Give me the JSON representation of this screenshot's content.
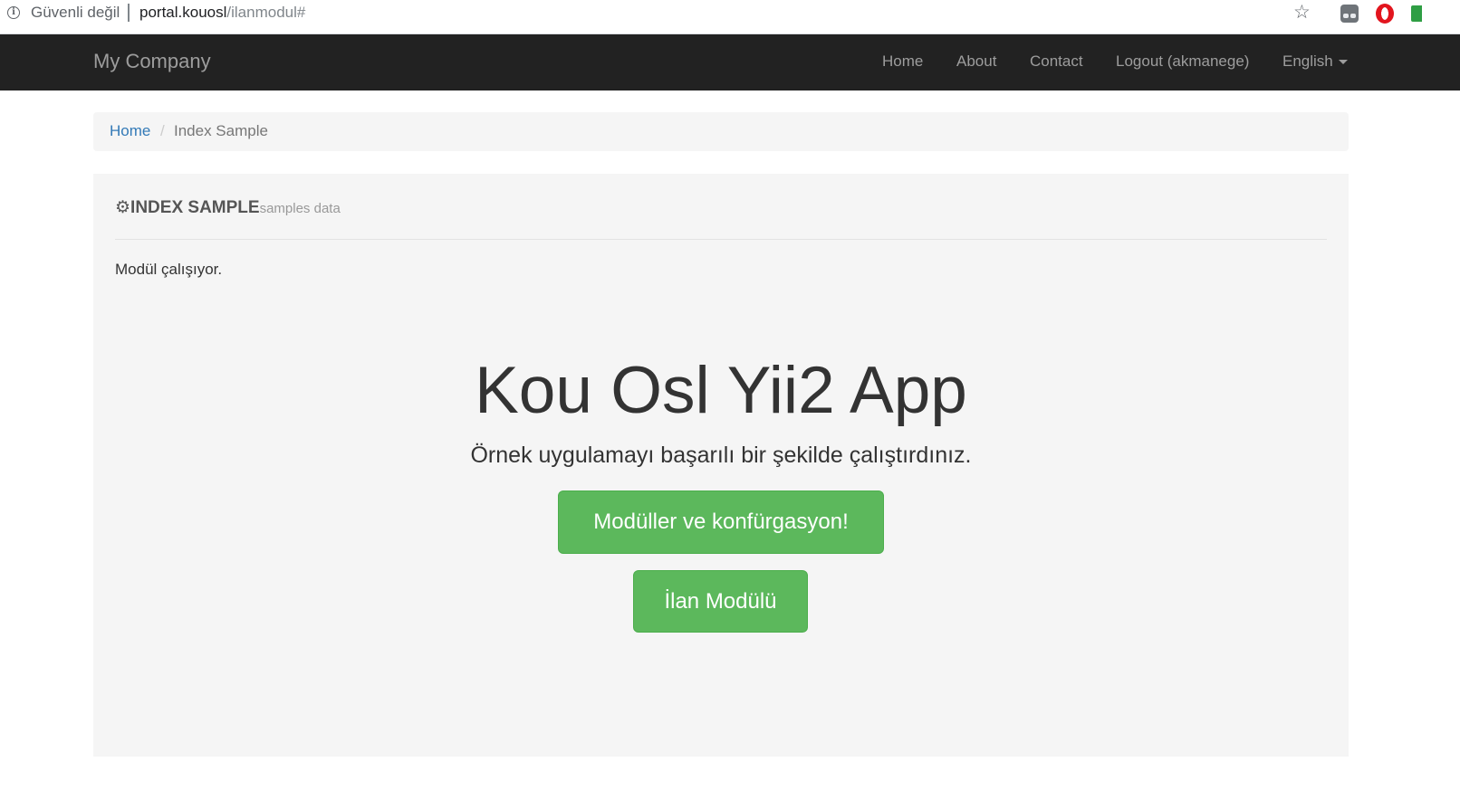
{
  "browser": {
    "security_label": "Güvenli değil",
    "url_host": "portal.kouosl",
    "url_path": "/ilanmodul#",
    "info_icon": "info-icon",
    "star_icon": "bookmark-star-icon",
    "extensions": [
      "incognito-icon",
      "opera-icon",
      "green-extension-icon"
    ]
  },
  "navbar": {
    "brand": "My Company",
    "items": [
      {
        "label": "Home"
      },
      {
        "label": "About"
      },
      {
        "label": "Contact"
      },
      {
        "label": "Logout (akmanege)"
      }
    ],
    "language": "English",
    "background": "#222222",
    "text_color": "#9d9d9d"
  },
  "breadcrumb": {
    "home": "Home",
    "separator": "/",
    "active": "Index Sample",
    "link_color": "#337ab7"
  },
  "panel": {
    "icon": "gear-icon",
    "title": "INDEX SAMPLE",
    "subtitle": "samples data",
    "status": "Modül çalışıyor."
  },
  "jumbotron": {
    "title": "Kou Osl Yii2 App",
    "lead": "Örnek uygulamayı başarılı bir şekilde çalıştırdınız.",
    "buttons": [
      {
        "label": "Modüller ve konfürgasyon!"
      },
      {
        "label": "İlan Modülü"
      }
    ],
    "button_color": "#5cb85c"
  }
}
